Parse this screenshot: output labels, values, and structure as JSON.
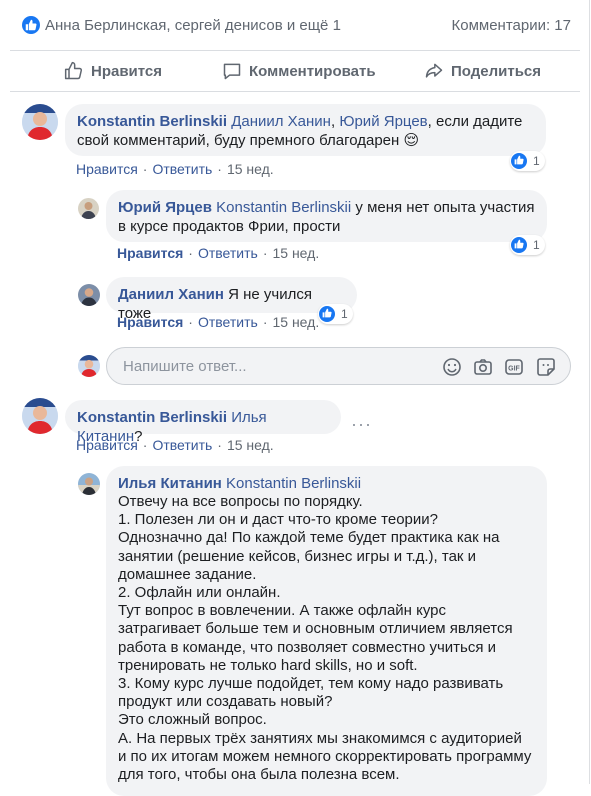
{
  "summary": {
    "reactors": "Анна Берлинская, сергей денисов и ещё 1",
    "comments": "Комментарии: 17"
  },
  "actions": {
    "like": "Нравится",
    "comment": "Комментировать",
    "share": "Поделиться"
  },
  "comments": [
    {
      "author": "Konstantin Berlinskii",
      "mention1": "Даниил Ханин",
      "sep1": ", ",
      "mention2": "Юрий Ярцев",
      "text": ", если дадите свой комментарий, буду премного благодарен 😌",
      "like": "Нравится",
      "reply": "Ответить",
      "time": "15 нед.",
      "reactions": "1"
    },
    {
      "author": "Юрий Ярцев",
      "mention": "Konstantin Berlinskii",
      "text": " у меня нет опыта участия в курсе продактов Фрии, прости",
      "like": "Нравится",
      "reply": "Ответить",
      "time": "15 нед.",
      "reactions": "1"
    },
    {
      "author": "Даниил Ханин",
      "text": " Я не учился тоже",
      "like": "Нравится",
      "reply": "Ответить",
      "time": "15 нед.",
      "reactions": "1"
    },
    {
      "author": "Konstantin Berlinskii",
      "mention": "Илья Китанин",
      "text": "?",
      "like": "Нравится",
      "reply": "Ответить",
      "time": "15 нед."
    },
    {
      "author": "Илья Китанин",
      "mention": "Konstantin Berlinskii",
      "text": "Отвечу на все вопросы по порядку.\n1. Полезен ли он и даст что-то кроме теории?\nОднозначно да! По каждой теме будет практика как на занятии (решение кейсов, бизнес игры и т.д.), так и домашнее задание.\n2. Офлайн или онлайн.\nТут вопрос в вовлечении. А также офлайн курс затрагивает больше тем и основным отличием является работа в команде, что позволяет совместно учиться и тренировать не только hard skills, но и soft.\n3. Кому курс лучше подойдет, тем кому надо развивать продукт или создавать новый?\nЭто сложный вопрос.\nA. На первых трёх занятиях мы знакомимся с аудиторией и по их итогам можем немного скорректировать программу для того, чтобы она была полезна всем."
    }
  ],
  "reply_box": {
    "placeholder": "Напишите ответ..."
  },
  "colors": {
    "accent": "#1877f2",
    "link": "#385898",
    "muted": "#606770",
    "bubble": "#f2f3f5"
  },
  "icons": [
    "like-icon",
    "thumb-up-icon",
    "comment-icon",
    "share-icon",
    "emoji-icon",
    "camera-icon",
    "gif-icon",
    "sticker-icon",
    "more-icon"
  ]
}
